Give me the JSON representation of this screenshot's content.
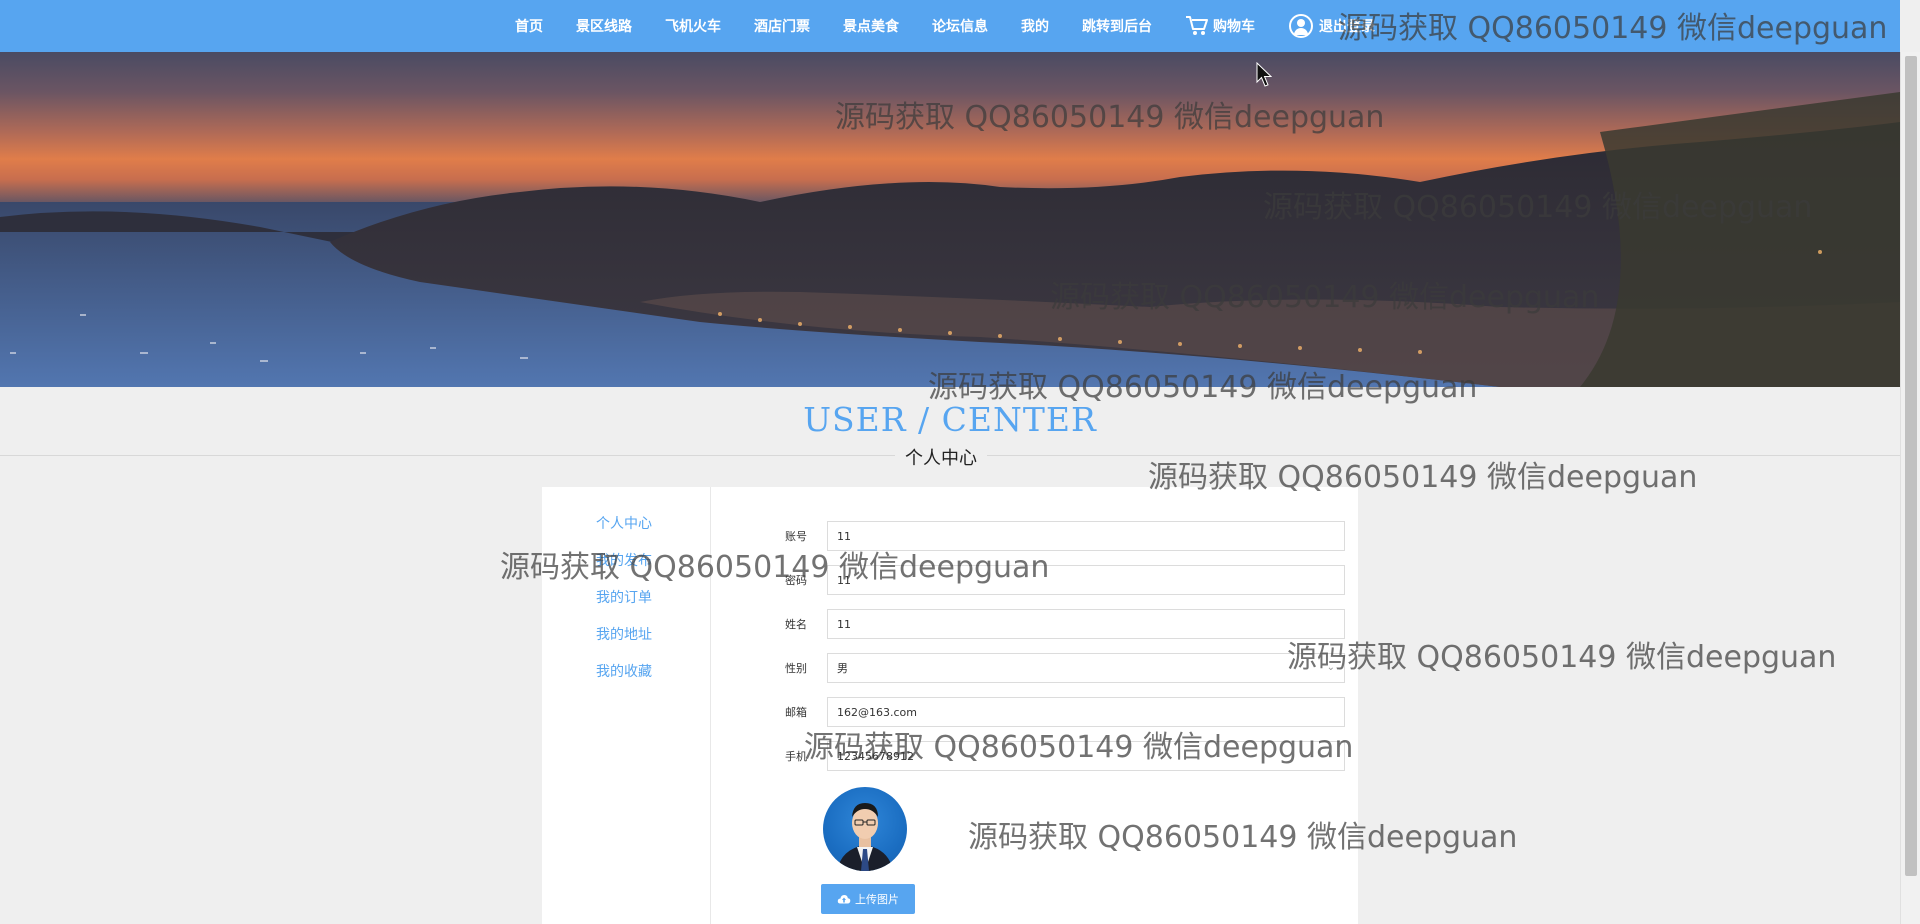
{
  "nav": {
    "items": [
      "首页",
      "景区线路",
      "飞机火车",
      "酒店门票",
      "景点美食",
      "论坛信息",
      "我的",
      "跳转到后台"
    ],
    "cart_label": "购物车",
    "user_label": "退出登录",
    "color": "#57a5f0"
  },
  "section": {
    "title": "USER / CENTER",
    "subtitle": "个人中心"
  },
  "sidebar": {
    "items": [
      "个人中心",
      "我的发布",
      "我的订单",
      "我的地址",
      "我的收藏"
    ]
  },
  "form": {
    "account_label": "账号",
    "account_value": "11",
    "password_label": "密码",
    "password_value": "11",
    "name_label": "姓名",
    "name_value": "11",
    "gender_label": "性别",
    "gender_value": "男",
    "email_label": "邮箱",
    "email_value": "162@163.com",
    "phone_label": "手机",
    "phone_value": "12345678912",
    "upload_label": "上传图片"
  },
  "watermark": {
    "text": "源码获取 QQ86050149 微信deepguan"
  }
}
